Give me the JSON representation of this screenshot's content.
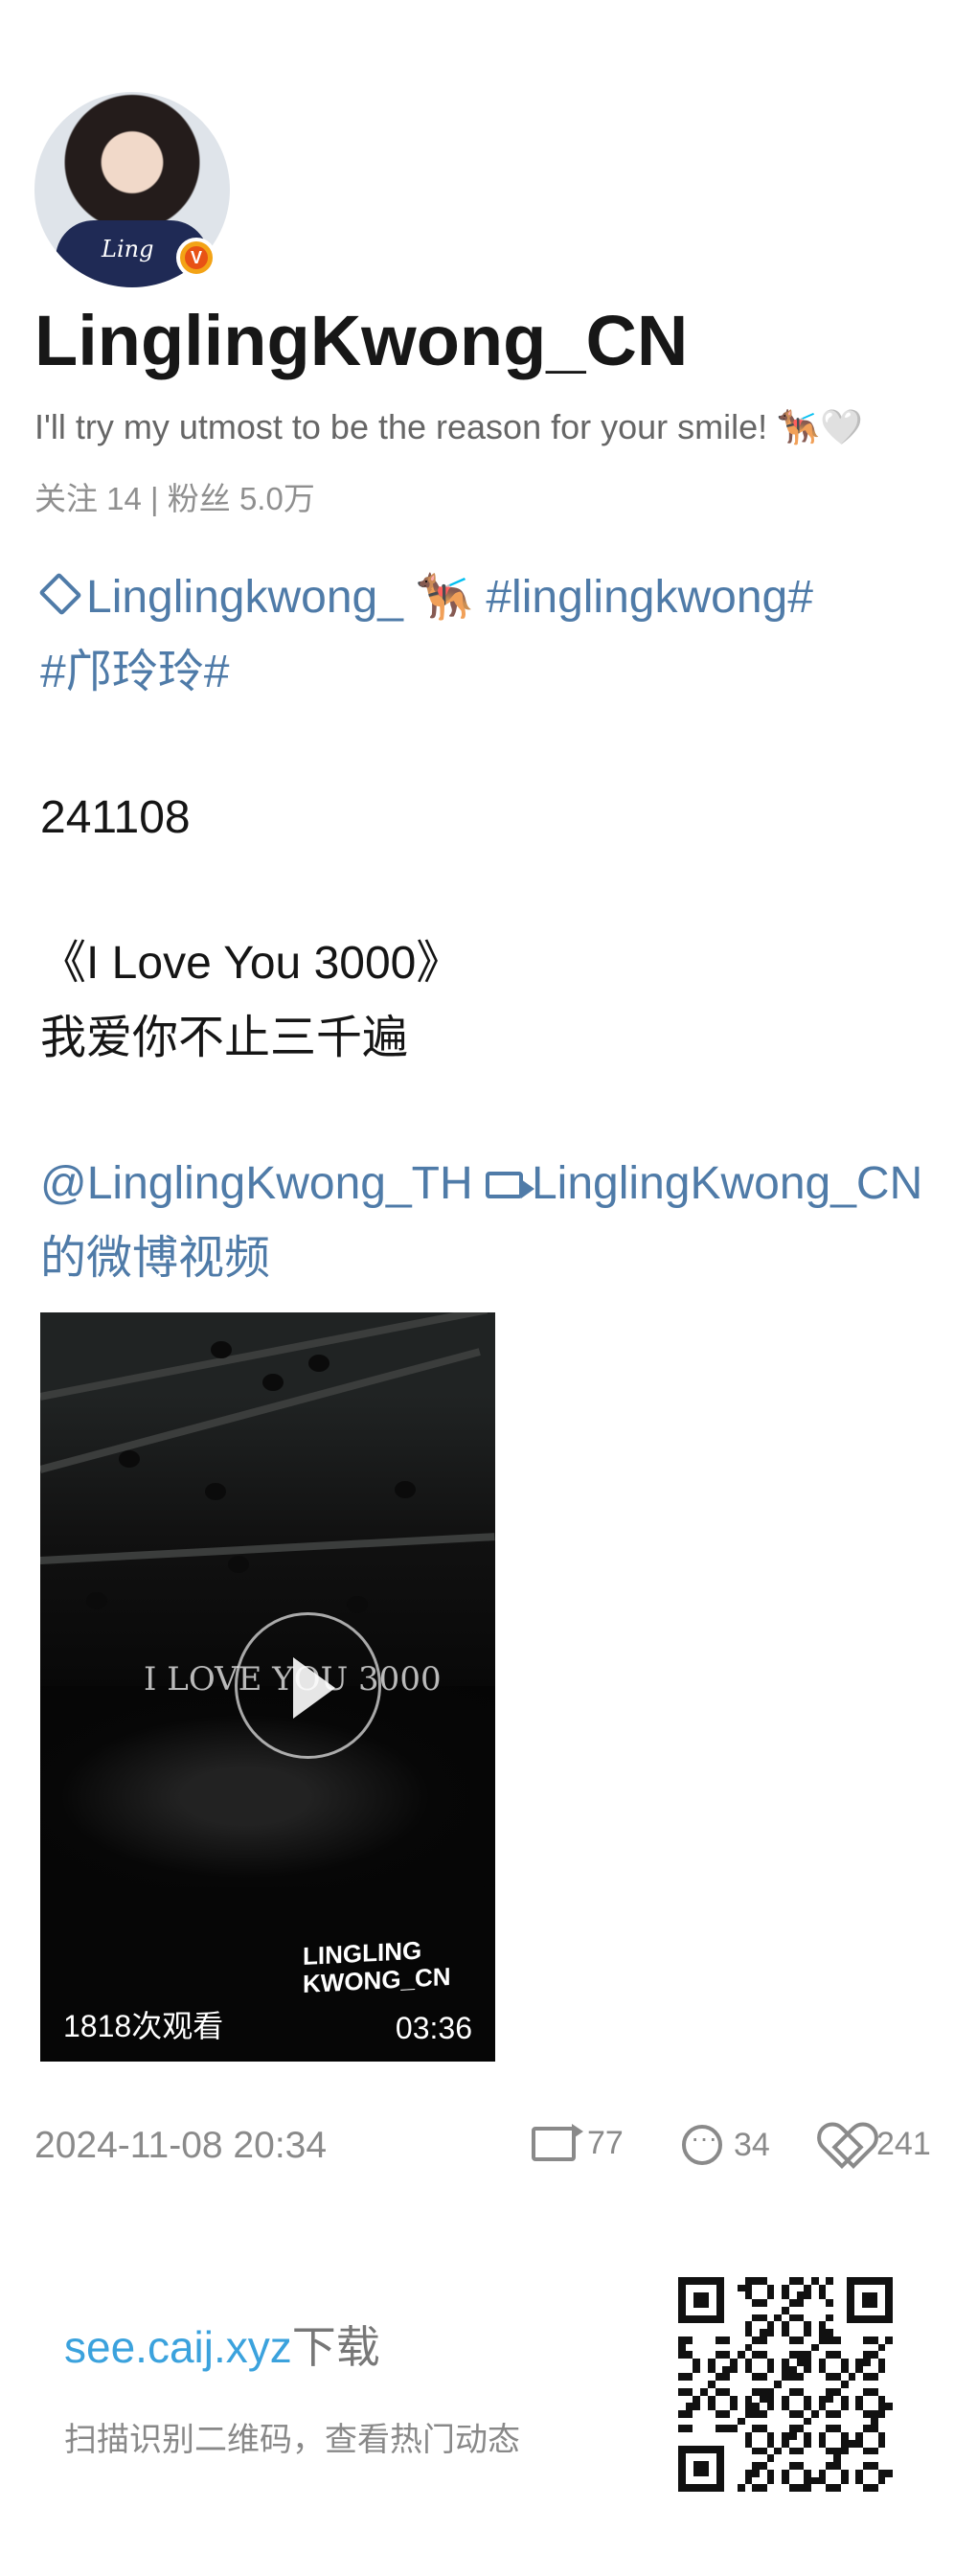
{
  "profile": {
    "username": "LinglingKwong_CN",
    "bio": "I'll try my utmost to be the reason for your smile! 🐕‍🦺🤍",
    "stats": "关注 14 | 粉丝 5.0万",
    "avatar_text": "Ling"
  },
  "post": {
    "tag_line_1": "Linglingkwong_ 🐕‍🦺 #linglingkwong#",
    "tag_line_2": "#邝玲玲#",
    "date_code": "241108",
    "song_title": "《I Love You 3000》",
    "chinese_caption": "我爱你不止三千遍",
    "mention": "@LinglingKwong_TH",
    "video_link": "LinglingKwong_CN",
    "video_suffix": "的微博视频"
  },
  "video": {
    "caption": "I LOVE YOU 3000",
    "watermark_1": "LINGLING",
    "watermark_2": "KWONG_CN",
    "views": "1818次观看",
    "duration": "03:36"
  },
  "footer": {
    "timestamp": "2024-11-08 20:34",
    "reposts": "77",
    "comments": "34",
    "likes": "241"
  },
  "qr": {
    "url": "see.caij.xyz",
    "download": "下载",
    "tip": "扫描识别二维码，查看热门动态"
  },
  "icons": {
    "badge": "verified-badge-icon",
    "repost": "repost-icon",
    "comment": "comment-icon",
    "like": "heart-icon",
    "play": "play-icon"
  }
}
